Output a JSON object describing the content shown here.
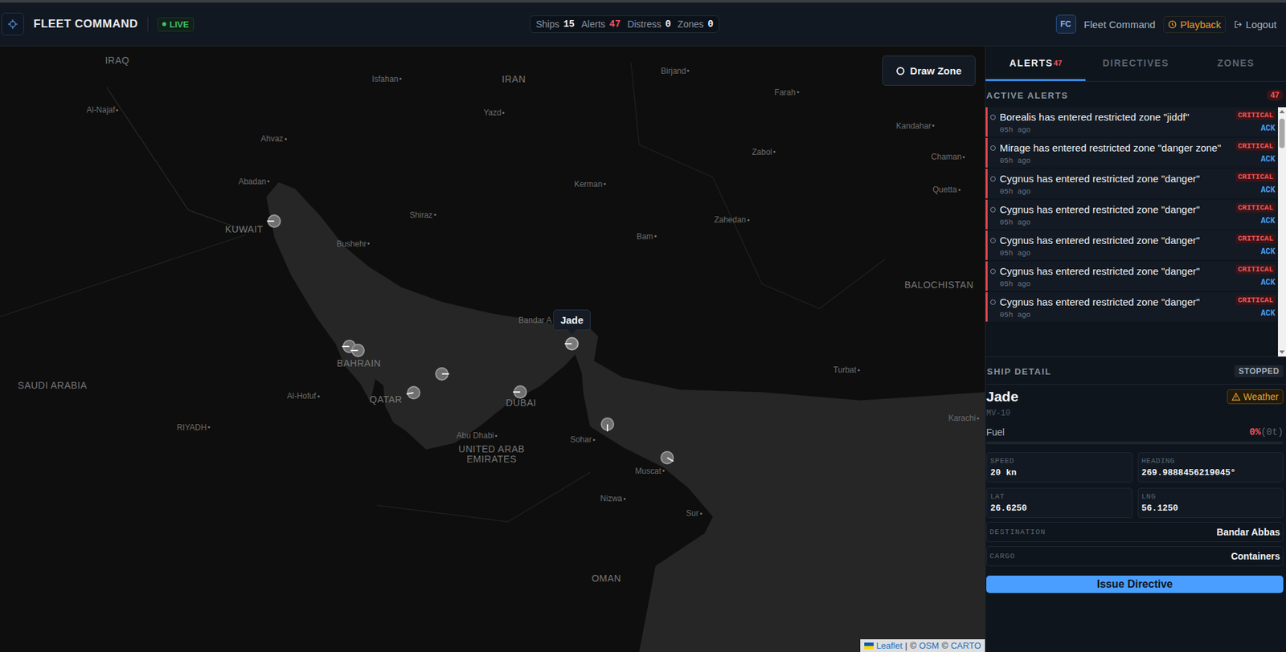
{
  "header": {
    "title": "FLEET COMMAND",
    "live": "LIVE",
    "stats": [
      {
        "label": "Ships",
        "value": "15",
        "alert": false
      },
      {
        "label": "Alerts",
        "value": "47",
        "alert": true
      },
      {
        "label": "Distress",
        "value": "0",
        "alert": false
      },
      {
        "label": "Zones",
        "value": "0",
        "alert": false
      }
    ],
    "avatar": "FC",
    "user": "Fleet Command",
    "playback": "Playback",
    "logout": "Logout"
  },
  "map": {
    "draw_zone": "Draw Zone",
    "tooltip": "Jade",
    "labels": [
      {
        "text": "IRAQ",
        "kind": "country"
      },
      {
        "text": "Al-Najaf",
        "kind": "city"
      },
      {
        "text": "Isfahan",
        "kind": "city"
      },
      {
        "text": "IRAN",
        "kind": "country"
      },
      {
        "text": "Birjand",
        "kind": "city"
      },
      {
        "text": "Farah",
        "kind": "city"
      },
      {
        "text": "Kandahar",
        "kind": "city"
      },
      {
        "text": "Chaman",
        "kind": "city"
      },
      {
        "text": "Quetta",
        "kind": "city"
      },
      {
        "text": "Ahvaz",
        "kind": "city"
      },
      {
        "text": "Yazd",
        "kind": "city"
      },
      {
        "text": "Zabol",
        "kind": "city"
      },
      {
        "text": "Abadan",
        "kind": "city"
      },
      {
        "text": "KUWAIT",
        "kind": "country"
      },
      {
        "text": "Bushehr",
        "kind": "city"
      },
      {
        "text": "Shiraz",
        "kind": "city"
      },
      {
        "text": "Kerman",
        "kind": "city"
      },
      {
        "text": "Zahedan",
        "kind": "city"
      },
      {
        "text": "Bam",
        "kind": "city"
      },
      {
        "text": "BALOCHISTAN",
        "kind": "country"
      },
      {
        "text": "Bandar A",
        "kind": "place"
      },
      {
        "text": "BAHRAIN",
        "kind": "country"
      },
      {
        "text": "SAUDI ARABIA",
        "kind": "country"
      },
      {
        "text": "Al-Hofuf",
        "kind": "city"
      },
      {
        "text": "QATAR",
        "kind": "country"
      },
      {
        "text": "DUBAI",
        "kind": "country"
      },
      {
        "text": "Turbat",
        "kind": "city"
      },
      {
        "text": "Karachi",
        "kind": "city"
      },
      {
        "text": "RIYADH",
        "kind": "city"
      },
      {
        "text": "Abu Dhabi",
        "kind": "city"
      },
      {
        "text": "UNITED ARAB EMIRATES",
        "kind": "country"
      },
      {
        "text": "Sohar",
        "kind": "city"
      },
      {
        "text": "Muscat",
        "kind": "city"
      },
      {
        "text": "Nizwa",
        "kind": "city"
      },
      {
        "text": "Sur",
        "kind": "city"
      },
      {
        "text": "OMAN",
        "kind": "country"
      }
    ],
    "ships": [
      {
        "heading": 270,
        "selected": false
      },
      {
        "heading": 270,
        "selected": false
      },
      {
        "heading": 270,
        "selected": false
      },
      {
        "heading": 260,
        "selected": false
      },
      {
        "heading": 90,
        "selected": false
      },
      {
        "heading": 270,
        "selected": false
      },
      {
        "heading": 270,
        "selected": true
      },
      {
        "heading": 180,
        "selected": false
      },
      {
        "heading": 120,
        "selected": false
      }
    ],
    "attribution": [
      {
        "text": "Leaflet",
        "link": true
      },
      {
        "text": "|",
        "link": false
      },
      {
        "text": "©",
        "link": false
      },
      {
        "text": "OSM",
        "link": true
      },
      {
        "text": "©",
        "link": false
      },
      {
        "text": "CARTO",
        "link": true
      }
    ]
  },
  "panel": {
    "tabs": [
      {
        "label": "ALERTS",
        "count": "47",
        "selected": true
      },
      {
        "label": "DIRECTIVES",
        "count": "",
        "selected": false
      },
      {
        "label": "ZONES",
        "count": "",
        "selected": false
      }
    ],
    "alerts": {
      "title": "ACTIVE ALERTS",
      "count": "47",
      "items": [
        {
          "text": "Borealis has entered restricted zone \"jiddf\"",
          "time": "05h ago",
          "severity": "CRITICAL",
          "action": "ACK"
        },
        {
          "text": "Mirage has entered restricted zone \"danger zone\"",
          "time": "05h ago",
          "severity": "CRITICAL",
          "action": "ACK"
        },
        {
          "text": "Cygnus has entered restricted zone \"danger\"",
          "time": "05h ago",
          "severity": "CRITICAL",
          "action": "ACK"
        },
        {
          "text": "Cygnus has entered restricted zone \"danger\"",
          "time": "05h ago",
          "severity": "CRITICAL",
          "action": "ACK"
        },
        {
          "text": "Cygnus has entered restricted zone \"danger\"",
          "time": "05h ago",
          "severity": "CRITICAL",
          "action": "ACK"
        },
        {
          "text": "Cygnus has entered restricted zone \"danger\"",
          "time": "05h ago",
          "severity": "CRITICAL",
          "action": "ACK"
        },
        {
          "text": "Cygnus has entered restricted zone \"danger\"",
          "time": "05h ago",
          "severity": "CRITICAL",
          "action": "ACK"
        }
      ]
    },
    "ship_detail": {
      "title": "SHIP DETAIL",
      "status": "STOPPED",
      "name": "Jade",
      "warning": "Weather",
      "code": "MV-10",
      "fuel_label": "Fuel",
      "fuel_reading": "0%",
      "fuel_tons": "(0t)",
      "fuel_level": 0,
      "stats": [
        {
          "label": "SPEED",
          "value": "20 kn"
        },
        {
          "label": "HEADING",
          "value": "269.9888456219045°"
        },
        {
          "label": "LAT",
          "value": "26.6250"
        },
        {
          "label": "LNG",
          "value": "56.1250"
        }
      ],
      "rows": [
        {
          "label": "DESTINATION",
          "value": "Bandar Abbas"
        },
        {
          "label": "CARGO",
          "value": "Containers"
        }
      ],
      "button": "Issue Directive"
    }
  }
}
